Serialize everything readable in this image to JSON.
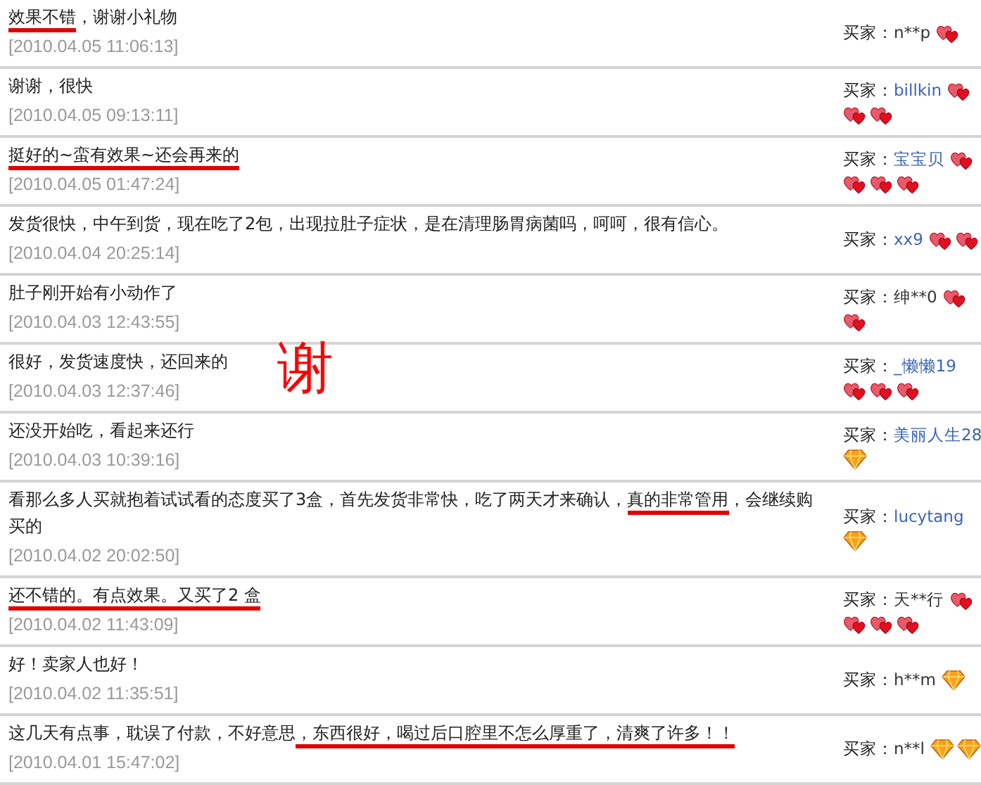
{
  "reviews": [
    {
      "comment": [
        {
          "text": "效果不错",
          "underlined": true
        },
        {
          "text": "，谢谢小礼物",
          "underlined": false
        }
      ],
      "time": "[2010.04.05 11:06:13]",
      "buyer_label": "买家：",
      "buyer": "n**p",
      "buyer_link": false,
      "badges": [
        {
          "kind": "heart"
        }
      ]
    },
    {
      "comment": [
        {
          "text": "谢谢，很快",
          "underlined": false
        }
      ],
      "time": "[2010.04.05 09:13:11]",
      "buyer_label": "买家：",
      "buyer": "billkin",
      "buyer_link": true,
      "badges": [
        {
          "kind": "heart"
        },
        {
          "kind": "heart"
        },
        {
          "kind": "heart"
        }
      ]
    },
    {
      "comment": [
        {
          "text": "挺好的~蛮有效果~还会再来的",
          "underlined": true
        }
      ],
      "time": "[2010.04.05 01:47:24]",
      "buyer_label": "买家：",
      "buyer": "宝宝贝",
      "buyer_link": true,
      "badges": [
        {
          "kind": "heart"
        },
        {
          "kind": "heart"
        },
        {
          "kind": "heart"
        },
        {
          "kind": "heart"
        }
      ]
    },
    {
      "comment": [
        {
          "text": "发货很快，中午到货，现在吃了2包，出现拉肚子症状，是在清理肠胃病菌吗，呵呵，很有信心。",
          "underlined": false
        }
      ],
      "time": "[2010.04.04 20:25:14]",
      "buyer_label": "买家：",
      "buyer": "xx9",
      "buyer_link": true,
      "badges": [
        {
          "kind": "heart"
        },
        {
          "kind": "heart"
        }
      ]
    },
    {
      "comment": [
        {
          "text": "肚子刚开始有小动作了",
          "underlined": false
        }
      ],
      "time": "[2010.04.03 12:43:55]",
      "buyer_label": "买家：",
      "buyer": "绅**0",
      "buyer_link": false,
      "badges": [
        {
          "kind": "heart"
        },
        {
          "kind": "heart"
        }
      ]
    },
    {
      "comment": [
        {
          "text": "很好，发货速度快，还回来的",
          "underlined": false
        }
      ],
      "time": "[2010.04.03 12:37:46]",
      "buyer_label": "买家：",
      "buyer": "_懒懒19",
      "buyer_link": true,
      "badges": [
        {
          "kind": "heart"
        },
        {
          "kind": "heart"
        },
        {
          "kind": "heart"
        }
      ]
    },
    {
      "comment": [
        {
          "text": "还没开始吃，看起来还行",
          "underlined": false
        }
      ],
      "time": "[2010.04.03 10:39:16]",
      "buyer_label": "买家：",
      "buyer": "美丽人生28",
      "buyer_link": true,
      "badges": [
        {
          "kind": "diamond"
        }
      ]
    },
    {
      "comment": [
        {
          "text": "看那么多人买就抱着试试看的态度买了3盒，首先发货非常快，吃了两天才来确认，",
          "underlined": false
        },
        {
          "text": "真的非常管用",
          "underlined": true
        },
        {
          "text": "，会继续购买的",
          "underlined": false
        }
      ],
      "time": "[2010.04.02 20:02:50]",
      "buyer_label": "买家：",
      "buyer": "lucytang",
      "buyer_link": true,
      "badges": [
        {
          "kind": "diamond"
        }
      ]
    },
    {
      "comment": [
        {
          "text": "还不错的。有点效果。又买了2 盒",
          "underlined": true
        }
      ],
      "time": "[2010.04.02 11:43:09]",
      "buyer_label": "买家：",
      "buyer": "天**行",
      "buyer_link": false,
      "badges": [
        {
          "kind": "heart"
        },
        {
          "kind": "heart"
        },
        {
          "kind": "heart"
        },
        {
          "kind": "heart"
        }
      ]
    },
    {
      "comment": [
        {
          "text": "好！卖家人也好！",
          "underlined": false
        }
      ],
      "time": "[2010.04.02 11:35:51]",
      "buyer_label": "买家：",
      "buyer": "h**m",
      "buyer_link": false,
      "badges": [
        {
          "kind": "diamond"
        }
      ]
    },
    {
      "comment": [
        {
          "text": "这几天有点事，耽误了付款，不好意思",
          "underlined": false
        },
        {
          "text": "，东西很好，喝过后口腔里不怎么厚重了，清爽了许多！！",
          "underlined": true
        }
      ],
      "time": "[2010.04.01 15:47:02]",
      "buyer_label": "买家：",
      "buyer": "n**l",
      "buyer_link": false,
      "badges": [
        {
          "kind": "diamond"
        },
        {
          "kind": "diamond"
        }
      ]
    }
  ],
  "overlay_char": "谢"
}
